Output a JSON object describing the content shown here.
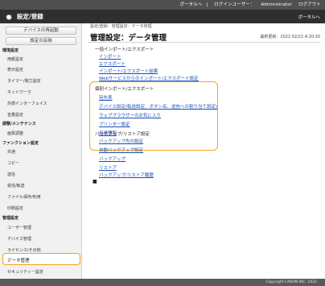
{
  "topbar": {
    "portal": "ポータルへ",
    "login_user": "ログインユーザー：",
    "user_name": "Administrator",
    "logout": "ログアウト"
  },
  "header": {
    "title": "設定/登録",
    "portal_link": "ポータルへ"
  },
  "sidebar": {
    "buttons": [
      "デバイスの再起動",
      "設定の反映"
    ],
    "groups": [
      {
        "heading": "環境設定",
        "items": [
          "用紙設定",
          "表示設定",
          "タイマー/電力設定",
          "ネットワーク",
          "外部インターフェイス",
          "音量設定"
        ]
      },
      {
        "heading": "調整/メンテナンス",
        "items": [
          "画質調整"
        ]
      },
      {
        "heading": "ファンクション設定",
        "items": [
          "共通",
          "コピー",
          "送信",
          "受信/転送",
          "ファイル保存/利用",
          "印刷設定"
        ]
      },
      {
        "heading": "管理設定",
        "items": [
          "ユーザー管理",
          "デバイス管理",
          "ライセンス/その他"
        ]
      }
    ],
    "selected": "データ管理",
    "after_selected": "セキュリティー設定"
  },
  "main": {
    "breadcrumb": "設定/登録：管理設定：データ管理",
    "title": "管理設定：データ管理",
    "updated": "最終更新：2022 02/22 4:20:20",
    "sections": [
      {
        "label": "一括インポート/エクスポート",
        "links": [
          "インポート",
          "エクスポート",
          "インポート/エクスポート結果",
          "Webサービスからのインポート/エクスポート設定"
        ]
      },
      {
        "label": "個別インポート/エクスポート",
        "links": [
          "宛先表",
          "デバイス設定(転送設定、ボタン名、送信への割り当て設定)",
          "ウェブブラウザーのお気に入り",
          "プリンター設定",
          "用紙情報"
        ]
      },
      {
        "label": "バックアップ/リストア設定",
        "links": [
          "バックアップ先の設定",
          "自動バックアップ設定",
          "バックアップ",
          "リストア",
          "バックアップ/リストア履歴"
        ]
      }
    ],
    "bullet": "■"
  },
  "footer": {
    "copyright": "Copyright CANON INC. 2022"
  },
  "colors": {
    "highlight": "#f2a41b",
    "link": "#1a4fb4",
    "header_bg": "#2f2f2f",
    "topbar_bg": "#505050"
  },
  "icons": {
    "header": "gear-icon"
  }
}
